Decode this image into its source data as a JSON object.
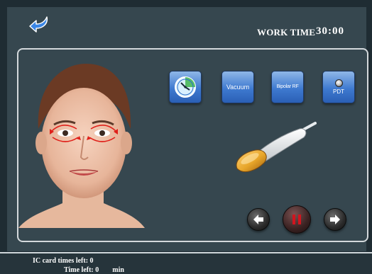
{
  "header": {
    "work_time_label": "WORK TIME",
    "work_time_value": "30:00",
    "back_icon": "back-arrow-icon"
  },
  "modes": [
    {
      "id": "timer",
      "label": "",
      "icon": "clock-icon"
    },
    {
      "id": "vacuum",
      "label": "Vacuum"
    },
    {
      "id": "bipolar-rf",
      "label": "Bipolar RF"
    },
    {
      "id": "pdt",
      "label": "PDT",
      "icon": "light-dot-icon"
    }
  ],
  "controls": {
    "prev_icon": "arrow-left-icon",
    "pause_icon": "pause-icon",
    "next_icon": "arrow-right-icon"
  },
  "footer": {
    "ic_card_label": "IC card times left: 0",
    "time_left_label": "Time left: 0",
    "time_left_unit": "min"
  },
  "colors": {
    "background": "#36474f",
    "button_blue": "#3f7ad0",
    "pause_red": "#d2141e",
    "handpiece_orange": "#e8a62a"
  }
}
